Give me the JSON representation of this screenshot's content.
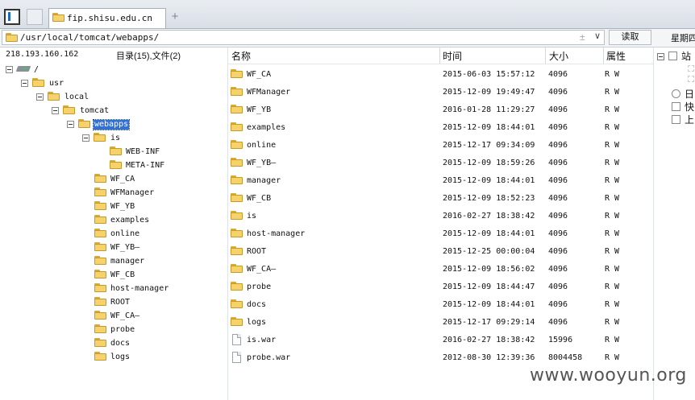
{
  "tabs": {
    "active_title": "fip.shisu.edu.cn",
    "new_tab_symbol": "+"
  },
  "address": {
    "path": "/usr/local/tomcat/webapps/",
    "plus_symbol": "±",
    "dropdown_symbol": "∨",
    "read_button": "读取"
  },
  "top_right": {
    "weekday_label": "星期四"
  },
  "left_panel": {
    "host": "218.193.160.162",
    "summary": "目录(15),文件(2)"
  },
  "tree": [
    {
      "label": "/",
      "icon": "drive-icon",
      "expanded": true,
      "depth": 0
    },
    {
      "label": "usr",
      "icon": "folder-icon",
      "expanded": true,
      "depth": 1
    },
    {
      "label": "local",
      "icon": "folder-icon",
      "expanded": true,
      "depth": 2
    },
    {
      "label": "tomcat",
      "icon": "folder-icon",
      "expanded": true,
      "depth": 3
    },
    {
      "label": "webapps",
      "icon": "folder-icon",
      "expanded": true,
      "depth": 4,
      "selected": true
    },
    {
      "label": "is",
      "icon": "folder-icon",
      "expanded": true,
      "depth": 5
    },
    {
      "label": "WEB-INF",
      "icon": "folder-icon",
      "depth": 6
    },
    {
      "label": "META-INF",
      "icon": "folder-icon",
      "depth": 6
    },
    {
      "label": "WF_CA",
      "icon": "folder-icon",
      "depth": 5
    },
    {
      "label": "WFManager",
      "icon": "folder-icon",
      "depth": 5
    },
    {
      "label": "WF_YB",
      "icon": "folder-icon",
      "depth": 5
    },
    {
      "label": "examples",
      "icon": "folder-icon",
      "depth": 5
    },
    {
      "label": "online",
      "icon": "folder-icon",
      "depth": 5
    },
    {
      "label": "WF_YB—",
      "icon": "folder-icon",
      "depth": 5
    },
    {
      "label": "manager",
      "icon": "folder-icon",
      "depth": 5
    },
    {
      "label": "WF_CB",
      "icon": "folder-icon",
      "depth": 5
    },
    {
      "label": "host-manager",
      "icon": "folder-icon",
      "depth": 5
    },
    {
      "label": "ROOT",
      "icon": "folder-icon",
      "depth": 5
    },
    {
      "label": "WF_CA—",
      "icon": "folder-icon",
      "depth": 5
    },
    {
      "label": "probe",
      "icon": "folder-icon",
      "depth": 5
    },
    {
      "label": "docs",
      "icon": "folder-icon",
      "depth": 5
    },
    {
      "label": "logs",
      "icon": "folder-icon",
      "depth": 5
    }
  ],
  "list": {
    "columns": [
      "名称",
      "时间",
      "大小",
      "属性"
    ],
    "rows": [
      {
        "name": "WF_CA",
        "type": "folder",
        "time": "2015-06-03 15:57:12",
        "size": "4096",
        "attr": "R W"
      },
      {
        "name": "WFManager",
        "type": "folder",
        "time": "2015-12-09 19:49:47",
        "size": "4096",
        "attr": "R W"
      },
      {
        "name": "WF_YB",
        "type": "folder",
        "time": "2016-01-28 11:29:27",
        "size": "4096",
        "attr": "R W"
      },
      {
        "name": "examples",
        "type": "folder",
        "time": "2015-12-09 18:44:01",
        "size": "4096",
        "attr": "R W"
      },
      {
        "name": "online",
        "type": "folder",
        "time": "2015-12-17 09:34:09",
        "size": "4096",
        "attr": "R W"
      },
      {
        "name": "WF_YB—",
        "type": "folder",
        "time": "2015-12-09 18:59:26",
        "size": "4096",
        "attr": "R W"
      },
      {
        "name": "manager",
        "type": "folder",
        "time": "2015-12-09 18:44:01",
        "size": "4096",
        "attr": "R W"
      },
      {
        "name": "WF_CB",
        "type": "folder",
        "time": "2015-12-09 18:52:23",
        "size": "4096",
        "attr": "R W"
      },
      {
        "name": "is",
        "type": "folder",
        "time": "2016-02-27 18:38:42",
        "size": "4096",
        "attr": "R W"
      },
      {
        "name": "host-manager",
        "type": "folder",
        "time": "2015-12-09 18:44:01",
        "size": "4096",
        "attr": "R W"
      },
      {
        "name": "ROOT",
        "type": "folder",
        "time": "2015-12-25 00:00:04",
        "size": "4096",
        "attr": "R W"
      },
      {
        "name": "WF_CA—",
        "type": "folder",
        "time": "2015-12-09 18:56:02",
        "size": "4096",
        "attr": "R W"
      },
      {
        "name": "probe",
        "type": "folder",
        "time": "2015-12-09 18:44:47",
        "size": "4096",
        "attr": "R W"
      },
      {
        "name": "docs",
        "type": "folder",
        "time": "2015-12-09 18:44:01",
        "size": "4096",
        "attr": "R W"
      },
      {
        "name": "logs",
        "type": "folder",
        "time": "2015-12-17 09:29:14",
        "size": "4096",
        "attr": "R W"
      },
      {
        "name": "is.war",
        "type": "file",
        "time": "2016-02-27 18:38:42",
        "size": "15996",
        "attr": "R W"
      },
      {
        "name": "probe.war",
        "type": "file",
        "time": "2012-08-30 12:39:36",
        "size": "8004458",
        "attr": "R W"
      }
    ]
  },
  "side_panel": {
    "items": [
      "站",
      "日",
      "快",
      "上"
    ]
  },
  "watermark": "www.wooyun.org"
}
